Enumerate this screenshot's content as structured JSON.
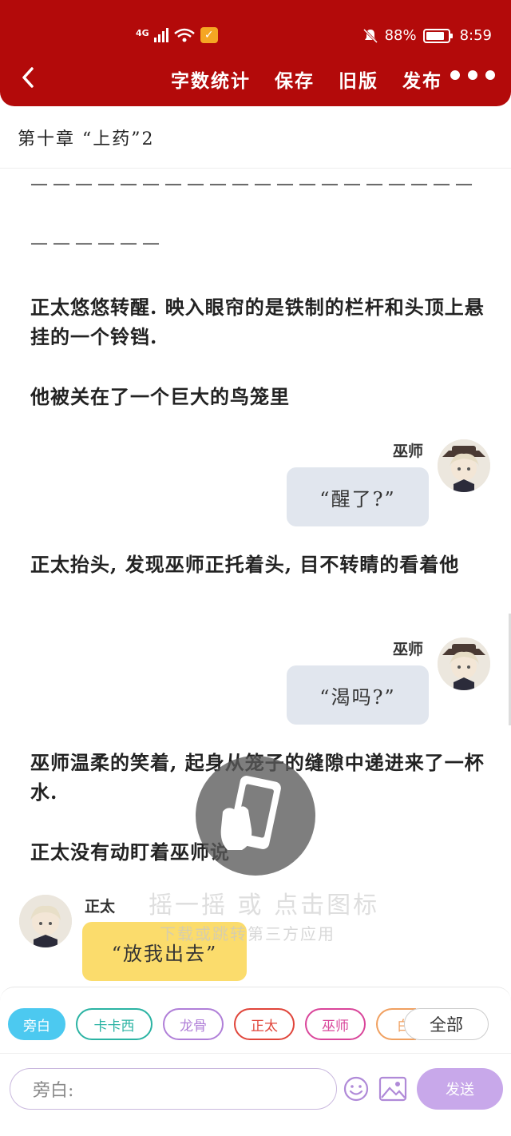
{
  "status_bar": {
    "network": "4G",
    "battery": "88%",
    "battery_level": 0.88,
    "time": "8:59"
  },
  "toolbar": {
    "word_count": "字数统计",
    "save": "保存",
    "old_version": "旧版",
    "publish": "发布"
  },
  "chapter_title": "第十章 “上药”2",
  "content": {
    "dash_line_1": "————————————————————",
    "dash_line_2": "——————",
    "para1": "正太悠悠转醒. 映入眼帘的是铁制的栏杆和头顶上悬挂的一个铃铛.",
    "para2": "他被关在了一个巨大的鸟笼里",
    "dialog1": {
      "speaker": "巫师",
      "text": "“醒了?”"
    },
    "para3": "正太抬头, 发现巫师正托着头, 目不转睛的看着他",
    "dialog2": {
      "speaker": "巫师",
      "text": "“渴吗?”"
    },
    "para4": "巫师温柔的笑着, 起身从笼子的缝隙中递进来了一杯水.",
    "para5": "正太没有动盯着巫师说",
    "dialog3": {
      "speaker": "正太",
      "text": "“放我出去”"
    }
  },
  "overlay": {
    "hint1": "摇一摇 或 点击图标",
    "hint2": "下载或跳转第三方应用"
  },
  "role_chips": [
    {
      "label": "旁白",
      "color": "#4cc9f0"
    },
    {
      "label": "卡卡西",
      "color": "#2bb3a3"
    },
    {
      "label": "龙骨",
      "color": "#b07fd8"
    },
    {
      "label": "正太",
      "color": "#e0453a"
    },
    {
      "label": "巫师",
      "color": "#d9459a"
    },
    {
      "label": "白",
      "color": "#f0a060"
    }
  ],
  "all_button": "全部",
  "input": {
    "placeholder": "旁白:"
  },
  "send_button": "发送",
  "colors": {
    "topbar": "#b30a0a",
    "send": "#c8a8ea",
    "bubble_gray": "#e1e6ee",
    "bubble_yellow": "#fbdc6c"
  }
}
